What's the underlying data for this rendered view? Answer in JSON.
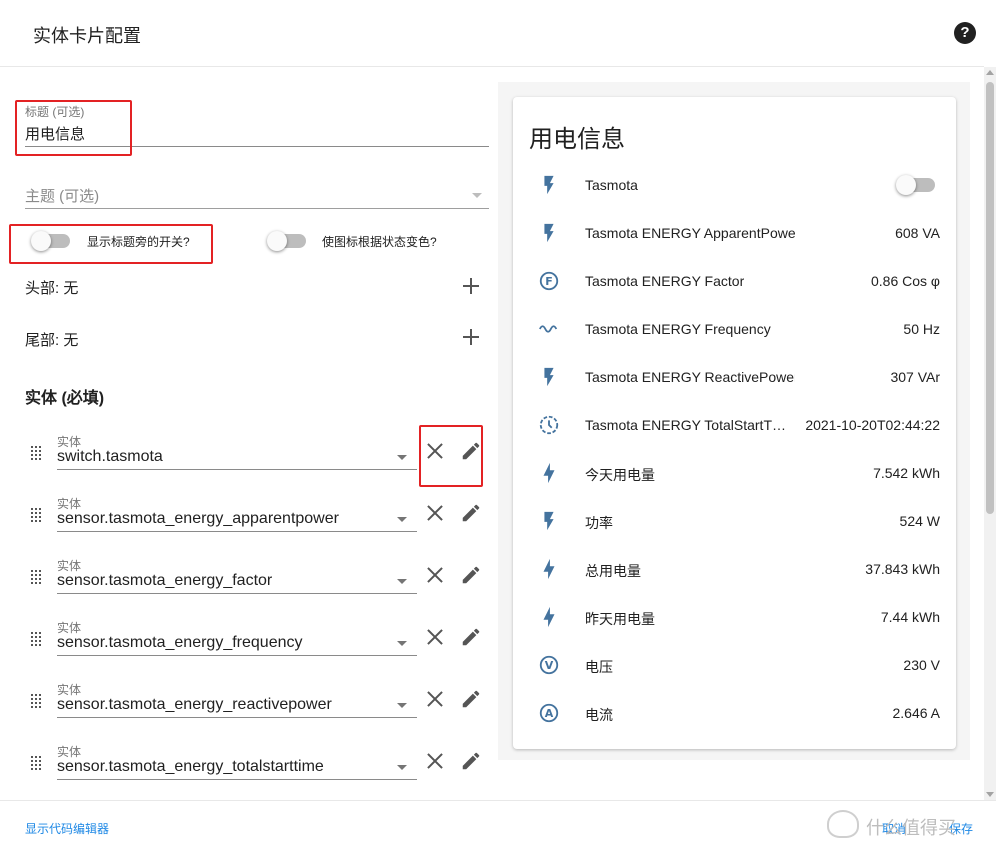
{
  "dialog": {
    "title": "实体卡片配置"
  },
  "editor": {
    "title_field": {
      "label": "标题 (可选)",
      "value": "用电信息"
    },
    "theme_field": {
      "placeholder": "主题 (可选)"
    },
    "toggles": [
      {
        "label": "显示标题旁的开关?",
        "on": false
      },
      {
        "label": "使图标根据状态变色?",
        "on": false
      }
    ],
    "header_row": "头部: 无",
    "footer_row": "尾部: 无",
    "entities_heading": "实体 (必填)",
    "entity_label": "实体",
    "entities": [
      "switch.tasmota",
      "sensor.tasmota_energy_apparentpower",
      "sensor.tasmota_energy_factor",
      "sensor.tasmota_energy_frequency",
      "sensor.tasmota_energy_reactivepower",
      "sensor.tasmota_energy_totalstarttime"
    ]
  },
  "preview": {
    "card_title": "用电信息",
    "icon_color": "#44739e",
    "rows": [
      {
        "icon": "flash-icon",
        "name": "Tasmota",
        "value": "",
        "toggle": true
      },
      {
        "icon": "flash-icon",
        "name": "Tasmota ENERGY ApparentPower",
        "value": "608 VA"
      },
      {
        "icon": "alpha-f-circle-icon",
        "name": "Tasmota ENERGY Factor",
        "value": "0.86 Cos φ"
      },
      {
        "icon": "sine-wave-icon",
        "name": "Tasmota ENERGY Frequency",
        "value": "50 Hz"
      },
      {
        "icon": "flash-icon",
        "name": "Tasmota ENERGY ReactivePower",
        "value": "307 VAr"
      },
      {
        "icon": "clock-outline-icon",
        "name": "Tasmota ENERGY TotalStartT…",
        "value": "2021-10-20T02:44:22"
      },
      {
        "icon": "lightning-icon",
        "name": "今天用电量",
        "value": "7.542 kWh"
      },
      {
        "icon": "flash-icon",
        "name": "功率",
        "value": "524 W"
      },
      {
        "icon": "lightning-icon",
        "name": "总用电量",
        "value": "37.843 kWh"
      },
      {
        "icon": "lightning-icon",
        "name": "昨天用电量",
        "value": "7.44 kWh"
      },
      {
        "icon": "alpha-v-circle-icon",
        "name": "电压",
        "value": "230 V"
      },
      {
        "icon": "alpha-a-circle-icon",
        "name": "电流",
        "value": "2.646 A"
      }
    ]
  },
  "footer": {
    "code_editor_link": "显示代码编辑器",
    "cancel_label": "取消",
    "save_label": "保存",
    "watermark": "什么值得买"
  },
  "colors": {
    "accent": "#1e88e5",
    "highlight_box": "#e32224"
  }
}
